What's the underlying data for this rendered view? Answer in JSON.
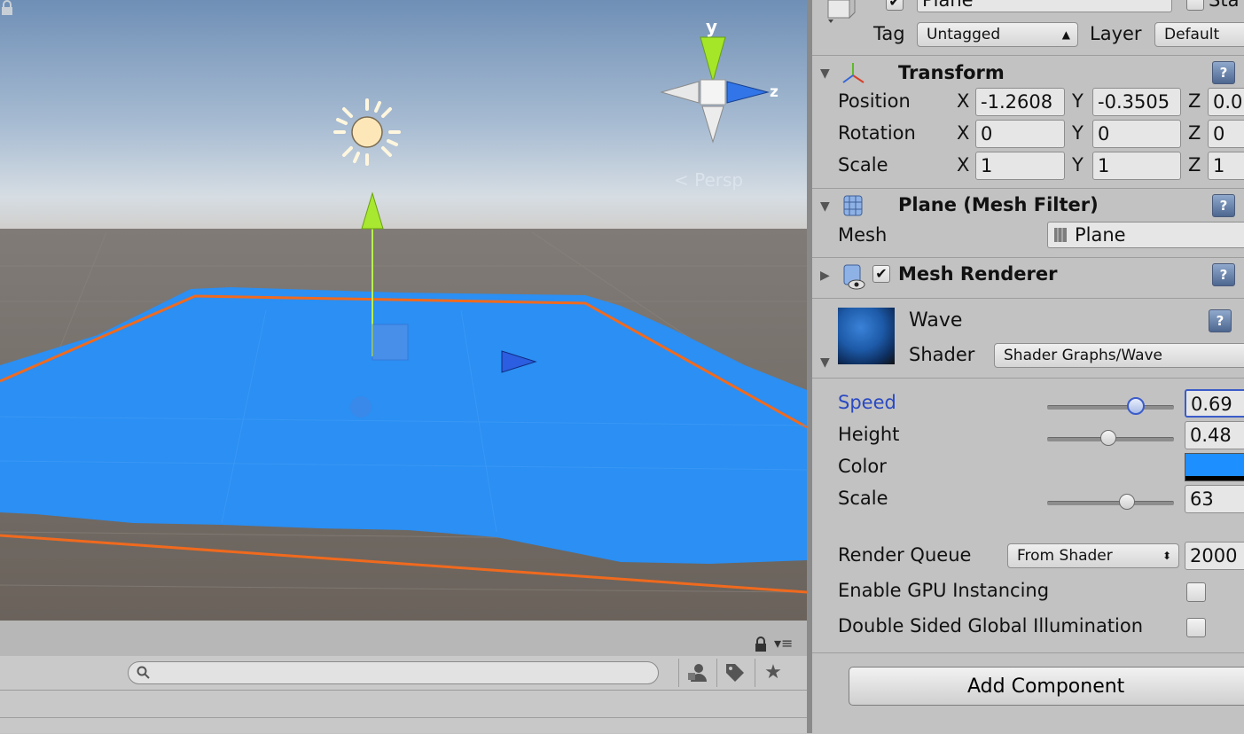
{
  "scene": {
    "persp_label": "< Persp",
    "gizmo_y_label": "y",
    "gizmo_z_label": "z"
  },
  "inspector": {
    "object": {
      "name_value": "Plane",
      "static_label": "Sta",
      "tag_label": "Tag",
      "tag_value": "Untagged",
      "layer_label": "Layer",
      "layer_value": "Default"
    },
    "transform": {
      "title": "Transform",
      "position_label": "Position",
      "rotation_label": "Rotation",
      "scale_label": "Scale",
      "axis_x": "X",
      "axis_y": "Y",
      "axis_z": "Z",
      "position": {
        "x": "-1.2608",
        "y": "-0.3505",
        "z": "0.0"
      },
      "rotation": {
        "x": "0",
        "y": "0",
        "z": "0"
      },
      "scale": {
        "x": "1",
        "y": "1",
        "z": "1"
      }
    },
    "mesh_filter": {
      "title": "Plane (Mesh Filter)",
      "mesh_label": "Mesh",
      "mesh_value": "Plane"
    },
    "mesh_renderer": {
      "title": "Mesh Renderer",
      "enabled": true
    },
    "material": {
      "name": "Wave",
      "shader_label": "Shader",
      "shader_value": "Shader Graphs/Wave",
      "properties": {
        "speed_label": "Speed",
        "speed_value": "0.69",
        "speed_fraction": 0.69,
        "height_label": "Height",
        "height_value": "0.48",
        "height_fraction": 0.48,
        "color_label": "Color",
        "color_hex": "#1e8fff",
        "scale_label": "Scale",
        "scale_value": "63",
        "scale_fraction": 0.63
      },
      "render_queue_label": "Render Queue",
      "render_queue_mode": "From Shader",
      "render_queue_value": "2000",
      "gpu_instancing_label": "Enable GPU Instancing",
      "double_sided_gi_label": "Double Sided Global Illumination"
    },
    "add_component_label": "Add Component"
  },
  "colors": {
    "water": "#2b8ff3",
    "selection_outline": "#f06a1e",
    "ground": "#6e6760",
    "accent_blue_label": "#2a49c2"
  },
  "icons": [
    "sun-icon",
    "scene-gizmo-icon",
    "lock-icon",
    "search-icon",
    "hierarchy-filter-icon",
    "tag-icon",
    "star-icon",
    "transform-icon",
    "mesh-filter-icon",
    "mesh-renderer-icon",
    "help-icon"
  ]
}
